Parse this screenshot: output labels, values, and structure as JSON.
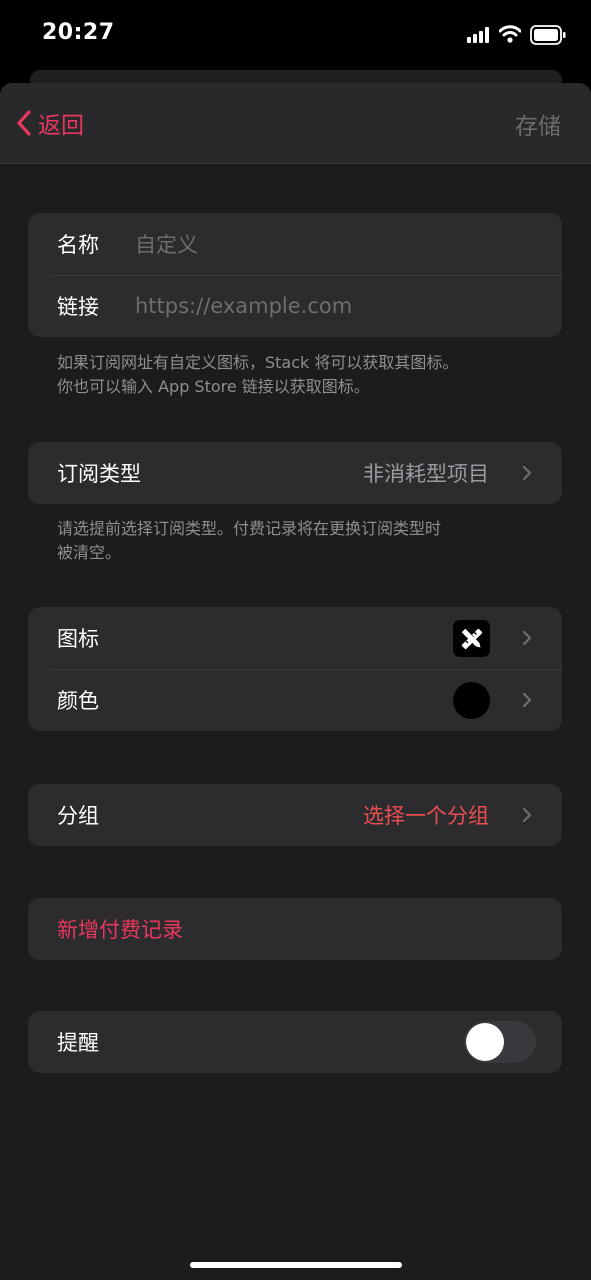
{
  "status_bar": {
    "time": "20:27"
  },
  "nav": {
    "back_label": "返回",
    "save_label": "存储"
  },
  "basic": {
    "name_label": "名称",
    "name_placeholder": "自定义",
    "link_label": "链接",
    "link_placeholder": "https://example.com",
    "note_line1": "如果订阅网址有自定义图标，Stack 将可以获取其图标。",
    "note_line2": "你也可以输入 App Store 链接以获取图标。"
  },
  "type": {
    "label": "订阅类型",
    "value": "非消耗型项目",
    "note_line1": "请选提前选择订阅类型。付费记录将在更换订阅类型时",
    "note_line2": "被清空。"
  },
  "appearance": {
    "icon_label": "图标",
    "icon_name": "pencil-ruler-icon",
    "color_label": "颜色",
    "color_value": "#000000"
  },
  "group": {
    "label": "分组",
    "value": "选择一个分组"
  },
  "payment": {
    "add_label": "新增付费记录"
  },
  "reminder": {
    "label": "提醒",
    "enabled": false
  },
  "colors": {
    "accent": "#e8375d",
    "group_value": "#e94e52"
  }
}
